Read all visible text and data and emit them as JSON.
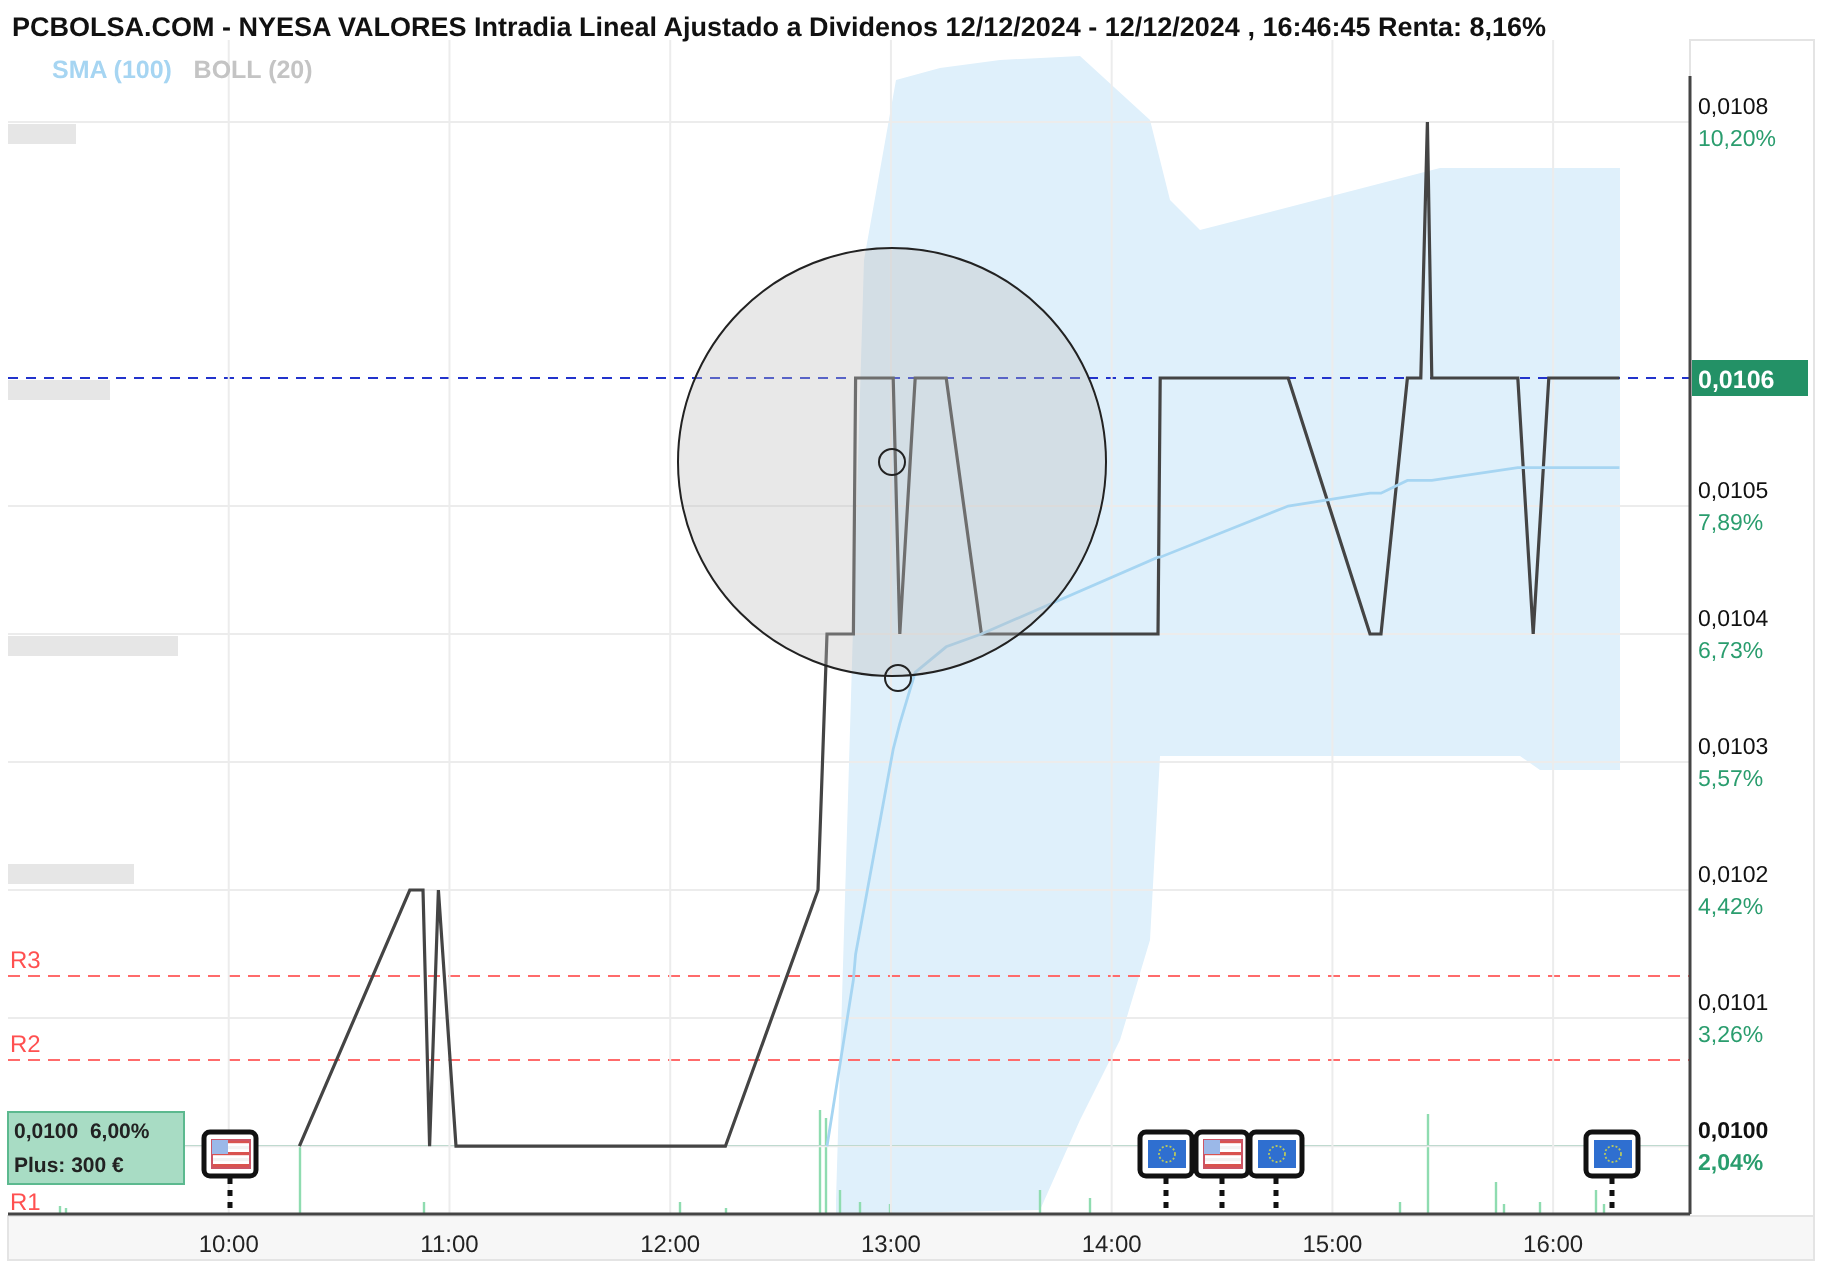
{
  "title": "PCBOLSA.COM - NYESA VALORES Intradia Lineal Ajustado a Dividenos 12/12/2024 - 12/12/2024 , 16:46:45 Renta: 8,16%",
  "chart_data": {
    "type": "line",
    "x": [
      10.32,
      10.82,
      10.88,
      10.91,
      10.95,
      11.03,
      12.25,
      12.67,
      12.71,
      12.83,
      12.84,
      13.01,
      13.04,
      13.11,
      13.25,
      13.41,
      14.21,
      14.22,
      14.8,
      15.17,
      15.22,
      15.34,
      15.4,
      15.43,
      15.45,
      15.84,
      15.91,
      15.98,
      16.3
    ],
    "series": [
      {
        "color": "#444444",
        "values": [
          0.01,
          0.0102,
          0.0102,
          0.01,
          0.0102,
          0.01,
          0.01,
          0.0102,
          0.0104,
          0.0104,
          0.0106,
          0.0106,
          0.0104,
          0.0106,
          0.0106,
          0.0104,
          0.0104,
          0.0106,
          0.0106,
          0.0104,
          0.0104,
          0.0106,
          0.0106,
          0.0108,
          0.0106,
          0.0106,
          0.0104,
          0.0106,
          0.0106
        ]
      },
      {
        "name": "SMA (100)",
        "color": "#a6d5f2",
        "values": [
          null,
          null,
          null,
          null,
          null,
          null,
          null,
          null,
          0.01,
          0.01013,
          0.01015,
          0.01031,
          0.01033,
          0.01037,
          0.01039,
          0.0104,
          0.01046,
          0.01046,
          0.0105,
          0.01051,
          0.01051,
          0.01052,
          0.01052,
          0.01052,
          0.01052,
          0.01053,
          0.01053,
          0.01053,
          0.01053
        ]
      }
    ],
    "xlim": [
      9.0,
      16.62
    ],
    "ylim": [
      0.009947,
      0.010864
    ],
    "xticks": [
      {
        "value": 10,
        "label": "10:00"
      },
      {
        "value": 11,
        "label": "11:00"
      },
      {
        "value": 12,
        "label": "12:00"
      },
      {
        "value": 13,
        "label": "13:00"
      },
      {
        "value": 14,
        "label": "14:00"
      },
      {
        "value": 15,
        "label": "15:00"
      },
      {
        "value": 16,
        "label": "16:00"
      }
    ],
    "yticks": [
      {
        "value": 0.0108,
        "label": "0,0108"
      },
      {
        "value": 0.0105,
        "label": "0,0105"
      },
      {
        "value": 0.0104,
        "label": "0,0104"
      },
      {
        "value": 0.0103,
        "label": "0,0103"
      },
      {
        "value": 0.0102,
        "label": "0,0102"
      },
      {
        "value": 0.0101,
        "label": "0,0101"
      },
      {
        "value": 0.01,
        "label": "0,0100"
      }
    ],
    "grid": true
  },
  "band": {
    "label": "BOLL (20)"
  },
  "percent_labels": [
    "10,20%",
    "7,89%",
    "6,73%",
    "5,57%",
    "4,42%",
    "3,26%",
    "2,04%"
  ],
  "levels": [
    {
      "kind": "resistance",
      "label": "R3"
    },
    {
      "kind": "resistance",
      "label": "R2"
    },
    {
      "kind": "resistance",
      "label": "R1"
    },
    {
      "kind": "last",
      "label": "0,0106"
    },
    {
      "kind": "position",
      "label": "0,0100  6,00%",
      "sublabel": "Plus: 300 €"
    }
  ],
  "events": [
    {
      "kind": "us"
    },
    {
      "kind": "eu"
    },
    {
      "kind": "us"
    },
    {
      "kind": "eu"
    },
    {
      "kind": "eu"
    }
  ]
}
